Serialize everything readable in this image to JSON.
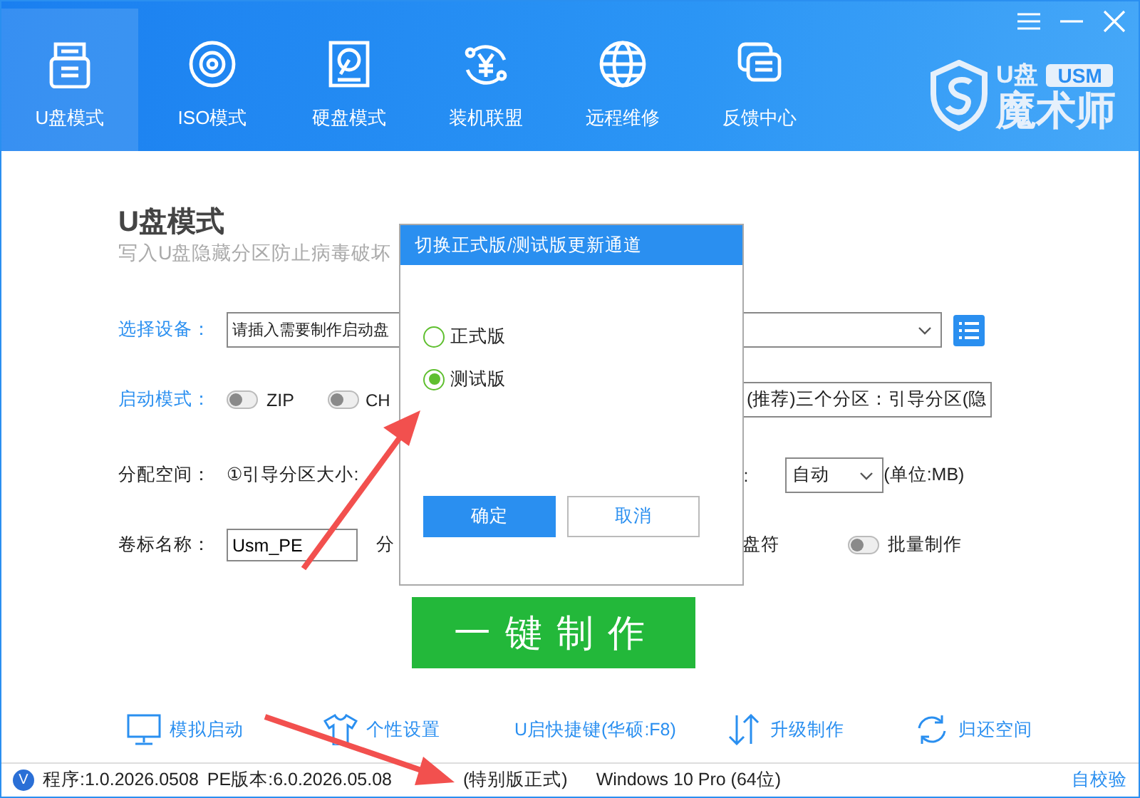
{
  "tabs": [
    {
      "label": "U盘模式",
      "kind": "usb",
      "selected": true
    },
    {
      "label": "ISO模式",
      "kind": "disc",
      "selected": false
    },
    {
      "label": "硬盘模式",
      "kind": "drive",
      "selected": false
    },
    {
      "label": "装机联盟",
      "kind": "coin",
      "selected": false
    },
    {
      "label": "远程维修",
      "kind": "globe",
      "selected": false
    },
    {
      "label": "反馈中心",
      "kind": "chat",
      "selected": false
    }
  ],
  "logo": {
    "top": "U盘",
    "badge": "USM",
    "name": "魔术师"
  },
  "page": {
    "title": "U盘模式",
    "subtitle": "写入U盘隐藏分区防止病毒破坏"
  },
  "device": {
    "label": "选择设备：",
    "value": "请插入需要制作启动盘"
  },
  "boot_mode": {
    "label": "启动模式：",
    "options": [
      {
        "label": "ZIP",
        "on": false
      },
      {
        "label": "CH",
        "on": false
      }
    ],
    "partition": "(推荐)三个分区：引导分区(隐"
  },
  "space": {
    "label": "分配空间：",
    "field_label": "①引导分区大小:",
    "label_2": ":",
    "value": "自动",
    "unit": "(单位:MB)"
  },
  "volume": {
    "label": "卷标名称：",
    "value": "Usm_PE",
    "label_2": "分",
    "label_3": "盘符",
    "batch": {
      "label": "批量制作",
      "on": false
    }
  },
  "make_button": "一键制作",
  "links": [
    {
      "label": "模拟启动",
      "kind": "monitor"
    },
    {
      "label": "个性设置",
      "kind": "shirt"
    },
    {
      "label": "U启快捷键(华硕:F8)",
      "kind": "none"
    },
    {
      "label": "升级制作",
      "kind": "updown"
    },
    {
      "label": "归还空间",
      "kind": "refresh"
    }
  ],
  "status_bar": {
    "badge": "V",
    "program": "程序:1.0.2026.0508",
    "pe_version": "PE版本:6.0.2026.05.08",
    "edition": "(特别版正式)",
    "os": "Windows 10 Pro (64位)",
    "self_check": "自校验"
  },
  "dialog": {
    "title": "切换正式版/测试版更新通道",
    "options": [
      {
        "label": "正式版",
        "selected": false
      },
      {
        "label": "测试版",
        "selected": true
      }
    ],
    "buttons": [
      "确定",
      "取消"
    ]
  }
}
